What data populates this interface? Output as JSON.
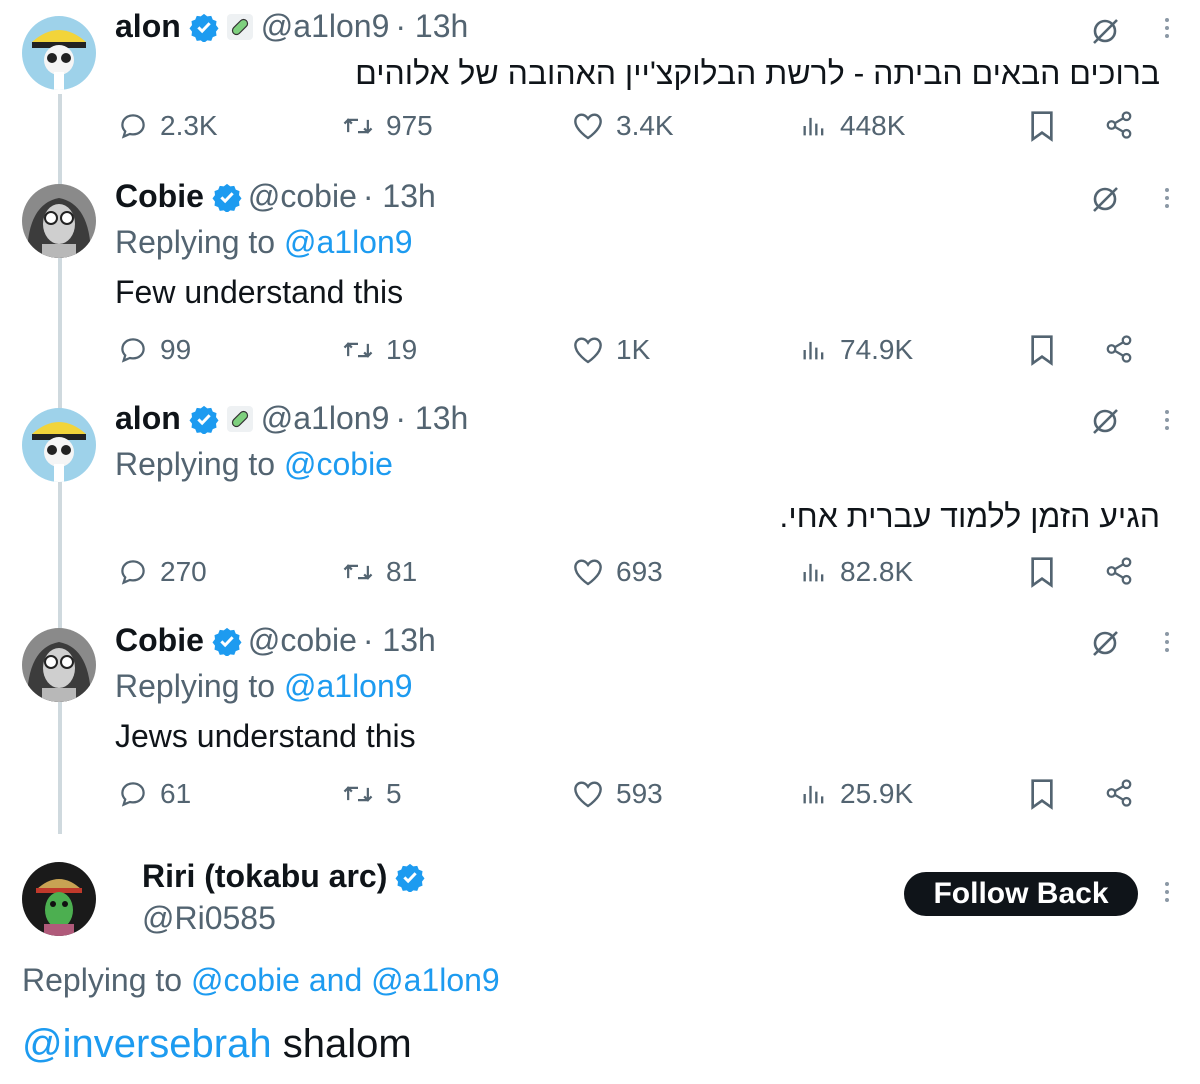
{
  "tweets": [
    {
      "name": "alon",
      "handle": "@a1lon9",
      "time": "· 13h",
      "text": "ברוכים הבאים הביתה - לרשת הבלוקצ'יין האהובה של אלוהים",
      "stats": {
        "replies": "2.3K",
        "reposts": "975",
        "likes": "3.4K",
        "views": "448K"
      }
    },
    {
      "name": "Cobie",
      "handle": "@cobie",
      "time": "· 13h",
      "replying_prefix": "Replying to",
      "replying_to": "@a1lon9",
      "text": "Few understand this",
      "stats": {
        "replies": "99",
        "reposts": "19",
        "likes": "1K",
        "views": "74.9K"
      }
    },
    {
      "name": "alon",
      "handle": "@a1lon9",
      "time": "· 13h",
      "replying_prefix": "Replying to",
      "replying_to": "@cobie",
      "text": "הגיע הזמן ללמוד עברית אחי.",
      "stats": {
        "replies": "270",
        "reposts": "81",
        "likes": "693",
        "views": "82.8K"
      }
    },
    {
      "name": "Cobie",
      "handle": "@cobie",
      "time": "· 13h",
      "replying_prefix": "Replying to",
      "replying_to": "@a1lon9",
      "text": "Jews understand this",
      "stats": {
        "replies": "61",
        "reposts": "5",
        "likes": "593",
        "views": "25.9K"
      }
    }
  ],
  "reply": {
    "name": "Riri (tokabu arc)",
    "handle": "@Ri0585",
    "follow_label": "Follow Back",
    "replying_prefix": "Replying to",
    "replying_to_1": "@cobie",
    "replying_and": "and",
    "replying_to_2": "@a1lon9",
    "mention": "@inversebrah",
    "text": "shalom"
  },
  "colors": {
    "accent": "#1d9bf0",
    "muted": "#536471",
    "text": "#0f1419",
    "thread_line": "#cfd9de"
  },
  "icons": [
    "verified-badge-icon",
    "pill-icon",
    "grok-icon",
    "more-icon",
    "reply-icon",
    "repost-icon",
    "like-icon",
    "views-icon",
    "bookmark-icon",
    "share-icon"
  ]
}
